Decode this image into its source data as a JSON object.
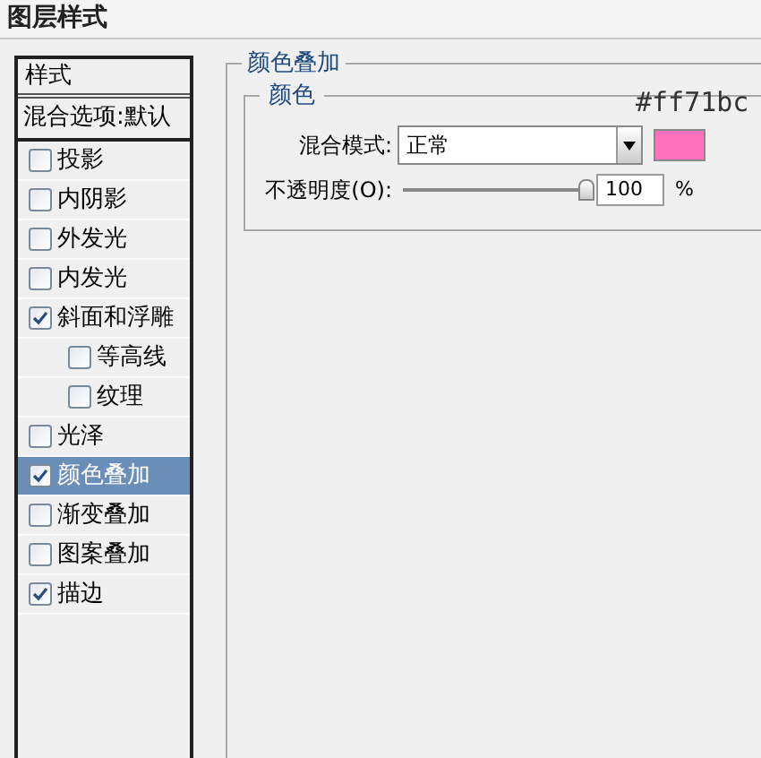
{
  "window": {
    "title": "图层样式"
  },
  "sidebar": {
    "header": "样式",
    "blending_options": "混合选项:默认",
    "items": [
      {
        "label": "投影",
        "checked": false,
        "selected": false
      },
      {
        "label": "内阴影",
        "checked": false,
        "selected": false
      },
      {
        "label": "外发光",
        "checked": false,
        "selected": false
      },
      {
        "label": "内发光",
        "checked": false,
        "selected": false
      },
      {
        "label": "斜面和浮雕",
        "checked": true,
        "selected": false,
        "children": [
          {
            "label": "等高线",
            "checked": false,
            "selected": false
          },
          {
            "label": "纹理",
            "checked": false,
            "selected": false
          }
        ]
      },
      {
        "label": "光泽",
        "checked": false,
        "selected": false
      },
      {
        "label": "颜色叠加",
        "checked": true,
        "selected": true
      },
      {
        "label": "渐变叠加",
        "checked": false,
        "selected": false
      },
      {
        "label": "图案叠加",
        "checked": false,
        "selected": false
      },
      {
        "label": "描边",
        "checked": true,
        "selected": false
      }
    ]
  },
  "panel": {
    "title": "颜色叠加",
    "group": {
      "title": "颜色",
      "annotation": "#ff71bc",
      "blend_mode": {
        "label": "混合模式:",
        "value": "正常"
      },
      "swatch": {
        "color": "#ff71bc"
      },
      "opacity": {
        "label": "不透明度(O):",
        "level": 1,
        "value": "100",
        "unit": "%"
      }
    }
  }
}
